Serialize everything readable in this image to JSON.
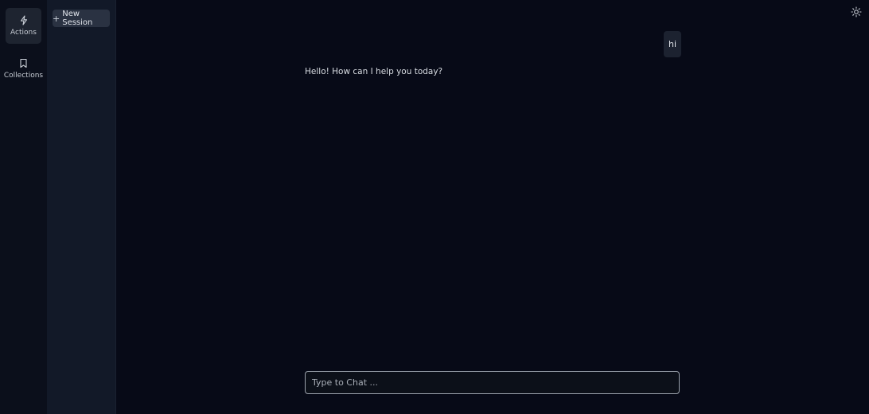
{
  "rail": {
    "items": [
      {
        "label": "Actions",
        "icon": "lightning-icon",
        "active": true
      },
      {
        "label": "Collections",
        "icon": "bookmark-icon",
        "active": false
      }
    ]
  },
  "sessions": {
    "new_session_label": "New Session",
    "new_session_icon": "+"
  },
  "header": {
    "theme_icon": "sun-icon"
  },
  "chat": {
    "messages": [
      {
        "role": "user",
        "text": "hi"
      },
      {
        "role": "assistant",
        "text": "Hello! How can I help you today?"
      }
    ],
    "input": {
      "value": "",
      "placeholder": "Type to Chat ..."
    }
  },
  "colors": {
    "background": "#070a17",
    "rail": "#0b0f1b",
    "sessions_panel": "#121928",
    "button": "#2a3242",
    "input_border": "#9aa1ab"
  }
}
